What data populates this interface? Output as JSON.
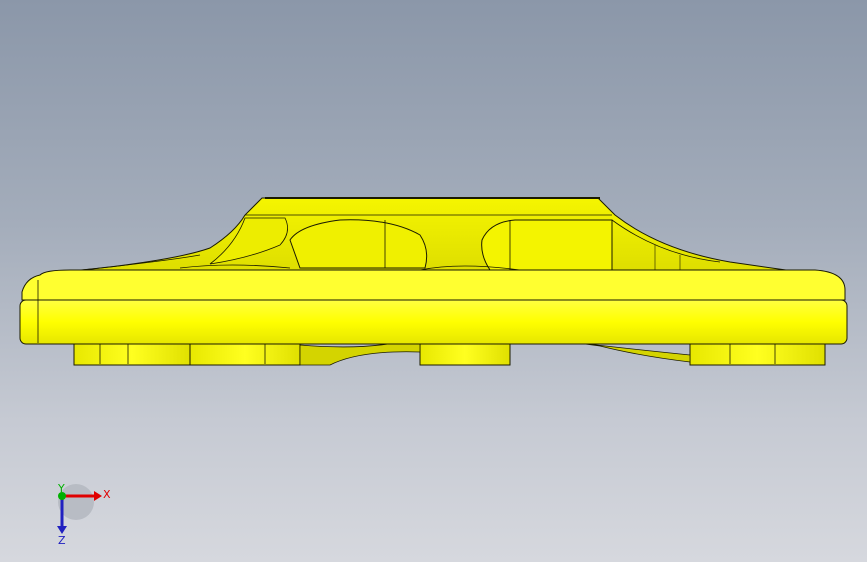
{
  "viewport": {
    "background_top": "#8b97a9",
    "background_bottom": "#d6d8de"
  },
  "model": {
    "part_color": "#ffff00",
    "edge_color": "#1a1a00",
    "shade_color": "#d9d900"
  },
  "triad": {
    "x_label": "X",
    "y_label": "Y",
    "z_label": "Z",
    "x_color": "#e00000",
    "y_color": "#00b000",
    "z_color": "#2020c0"
  }
}
